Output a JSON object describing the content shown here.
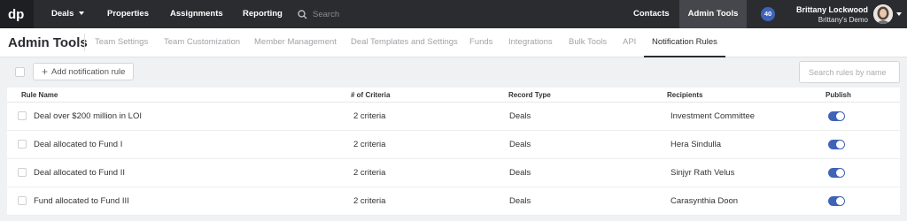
{
  "app": {
    "logo_text": "dp"
  },
  "topnav": {
    "deals": "Deals",
    "properties": "Properties",
    "assignments": "Assignments",
    "reporting": "Reporting",
    "search_placeholder": "Search",
    "contacts": "Contacts",
    "admin_tools": "Admin Tools",
    "notification_count": "40",
    "user_name": "Brittany Lockwood",
    "user_org": "Brittany's Demo"
  },
  "subheader": {
    "title": "Admin Tools",
    "tabs": [
      {
        "label": "Team Settings",
        "active": false
      },
      {
        "label": "Team Customization",
        "active": false
      },
      {
        "label": "Member Management",
        "active": false
      },
      {
        "label": "Deal Templates and Settings",
        "active": false
      },
      {
        "label": "Funds",
        "active": false
      },
      {
        "label": "Integrations",
        "active": false
      },
      {
        "label": "Bulk Tools",
        "active": false
      },
      {
        "label": "API",
        "active": false
      },
      {
        "label": "Notification Rules",
        "active": true
      }
    ]
  },
  "toolbar": {
    "add_label": "Add notification rule",
    "search_placeholder": "Search rules by name"
  },
  "table": {
    "columns": [
      "Rule Name",
      "# of Criteria",
      "Record Type",
      "Recipients",
      "Publish"
    ],
    "rows": [
      {
        "name": "Deal over $200 million in LOI",
        "criteria": "2 criteria",
        "record_type": "Deals",
        "recipients": "Investment Committee",
        "published": true
      },
      {
        "name": "Deal allocated to Fund I",
        "criteria": "2 criteria",
        "record_type": "Deals",
        "recipients": "Hera Sindulla",
        "published": true
      },
      {
        "name": "Deal allocated to Fund II",
        "criteria": "2 criteria",
        "record_type": "Deals",
        "recipients": "Sinjyr Rath Velus",
        "published": true
      },
      {
        "name": "Fund allocated to Fund III",
        "criteria": "2 criteria",
        "record_type": "Deals",
        "recipients": "Carasynthia Doon",
        "published": true
      }
    ]
  },
  "colors": {
    "topbar": "#2b2c30",
    "accent": "#3f63b6",
    "active_nav": "#45474c"
  }
}
